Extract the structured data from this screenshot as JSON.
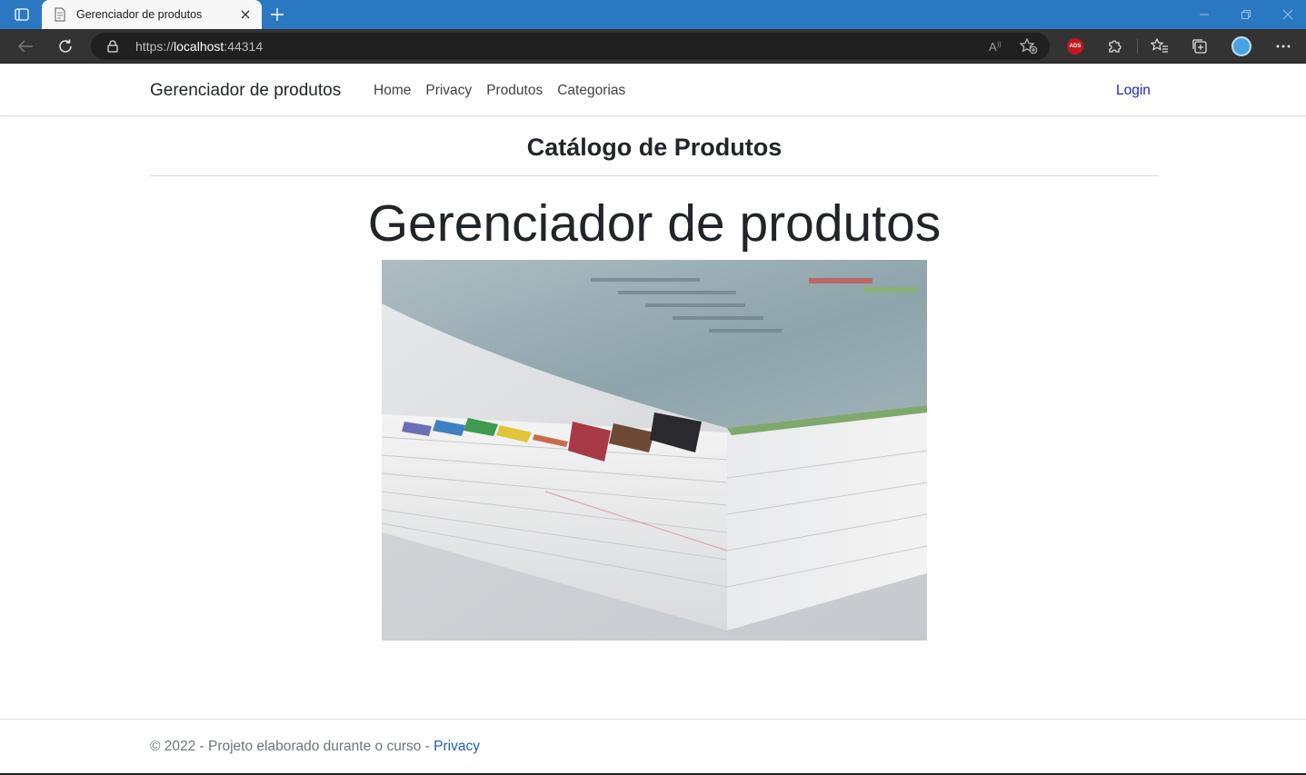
{
  "browser": {
    "tab_title": "Gerenciador de produtos",
    "url_scheme": "https://",
    "url_host": "localhost",
    "url_port": ":44314",
    "extension_badge": "ADS",
    "accent": "#2b78c2"
  },
  "navbar": {
    "brand": "Gerenciador de produtos",
    "links": [
      "Home",
      "Privacy",
      "Produtos",
      "Categorias"
    ],
    "login": "Login"
  },
  "main": {
    "catalog_title": "Catálogo de Produtos",
    "display_title": "Gerenciador de produtos"
  },
  "footer": {
    "text": "© 2022 - Projeto elaborado durante o curso - ",
    "privacy_link": "Privacy"
  },
  "colors": {
    "link": "#1a5fbf",
    "login": "#1a2bb8",
    "text": "#212529"
  }
}
